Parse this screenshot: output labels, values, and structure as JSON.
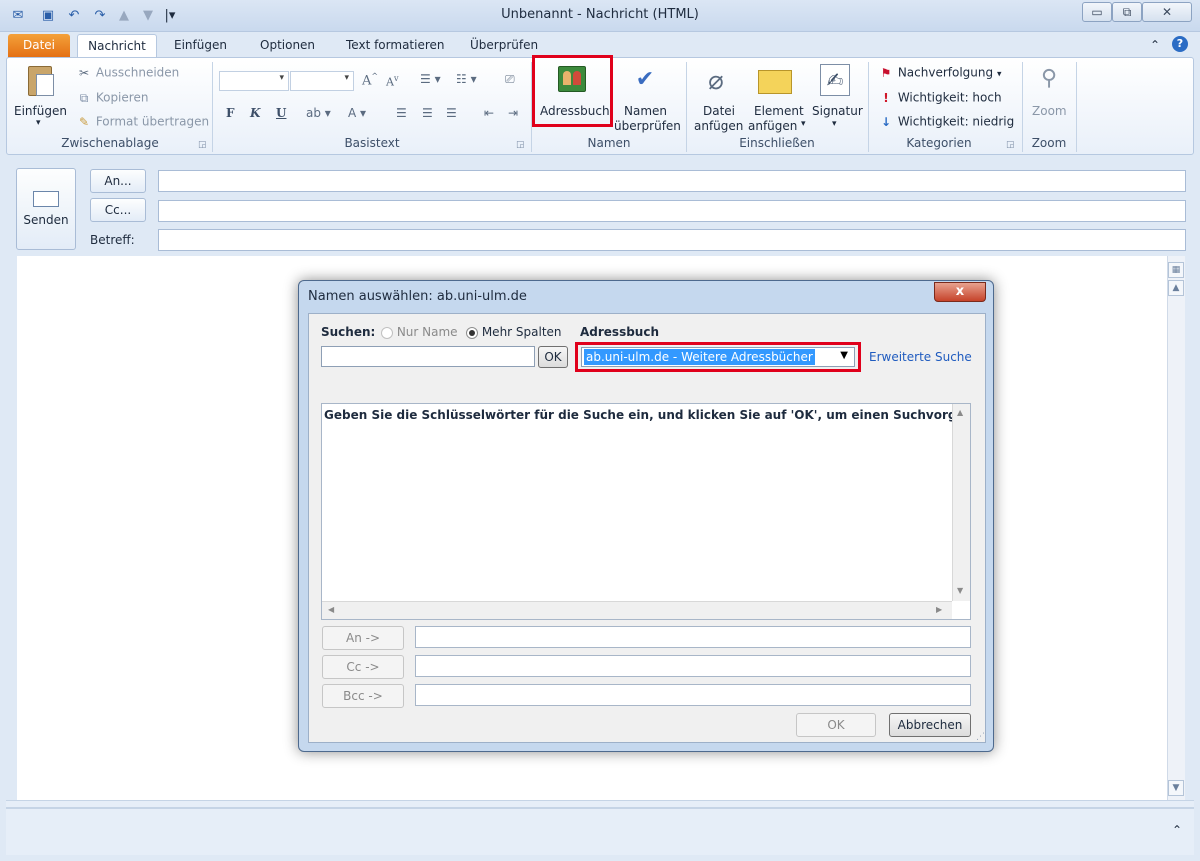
{
  "window": {
    "title": "Unbenannt  -  Nachricht (HTML)",
    "minimize": "▭",
    "maximize": "⧉",
    "close": "✕"
  },
  "quick_access": {
    "dropdown_glyph": "|▾"
  },
  "tabs": [
    "Datei",
    "Nachricht",
    "Einfügen",
    "Optionen",
    "Text formatieren",
    "Überprüfen"
  ],
  "ribbon": {
    "clipboard": {
      "paste": "Einfügen",
      "cut": "Ausschneiden",
      "copy": "Kopieren",
      "format_painter": "Format übertragen",
      "label": "Zwischenablage"
    },
    "basic_text": {
      "label": "Basistext",
      "bold": "F",
      "italic": "K",
      "underline": "U"
    },
    "names": {
      "address_book": "Adressbuch",
      "check_names_1": "Namen",
      "check_names_2": "überprüfen",
      "label": "Namen"
    },
    "include": {
      "attach_file_1": "Datei",
      "attach_file_2": "anfügen",
      "attach_item_1": "Element",
      "attach_item_2": "anfügen",
      "signature": "Signatur",
      "label": "Einschließen"
    },
    "tags": {
      "follow_up": "Nachverfolgung",
      "high": "Wichtigkeit: hoch",
      "low": "Wichtigkeit: niedrig",
      "label": "Kategorien"
    },
    "zoom": {
      "button": "Zoom",
      "label": "Zoom"
    }
  },
  "compose": {
    "send": "Senden",
    "to_button": "An...",
    "cc_button": "Cc...",
    "subject_label": "Betreff:",
    "to_value": "",
    "cc_value": "",
    "subject_value": ""
  },
  "dialog": {
    "title": "Namen auswählen: ab.uni-ulm.de",
    "close": "x",
    "search_label": "Suchen:",
    "radio_name_only": "Nur Name",
    "radio_more_columns": "Mehr Spalten",
    "search_value": "",
    "ok_small": "OK",
    "address_book_label": "Adressbuch",
    "address_book_value": "ab.uni-ulm.de - Weitere Adressbücher",
    "advanced_search": "Erweiterte Suche",
    "results_message": "Geben Sie die Schlüsselwörter für die Suche ein, und klicken Sie auf 'OK', um einen Suchvorgang au...",
    "to_button": "An ->",
    "cc_button": "Cc ->",
    "bcc_button": "Bcc ->",
    "to_value": "",
    "cc_value": "",
    "bcc_value": "",
    "ok": "OK",
    "cancel": "Abbrechen"
  },
  "colors": {
    "highlight": "#e0001b",
    "datei_tab": "#e8761e",
    "selection": "#3399ff"
  }
}
